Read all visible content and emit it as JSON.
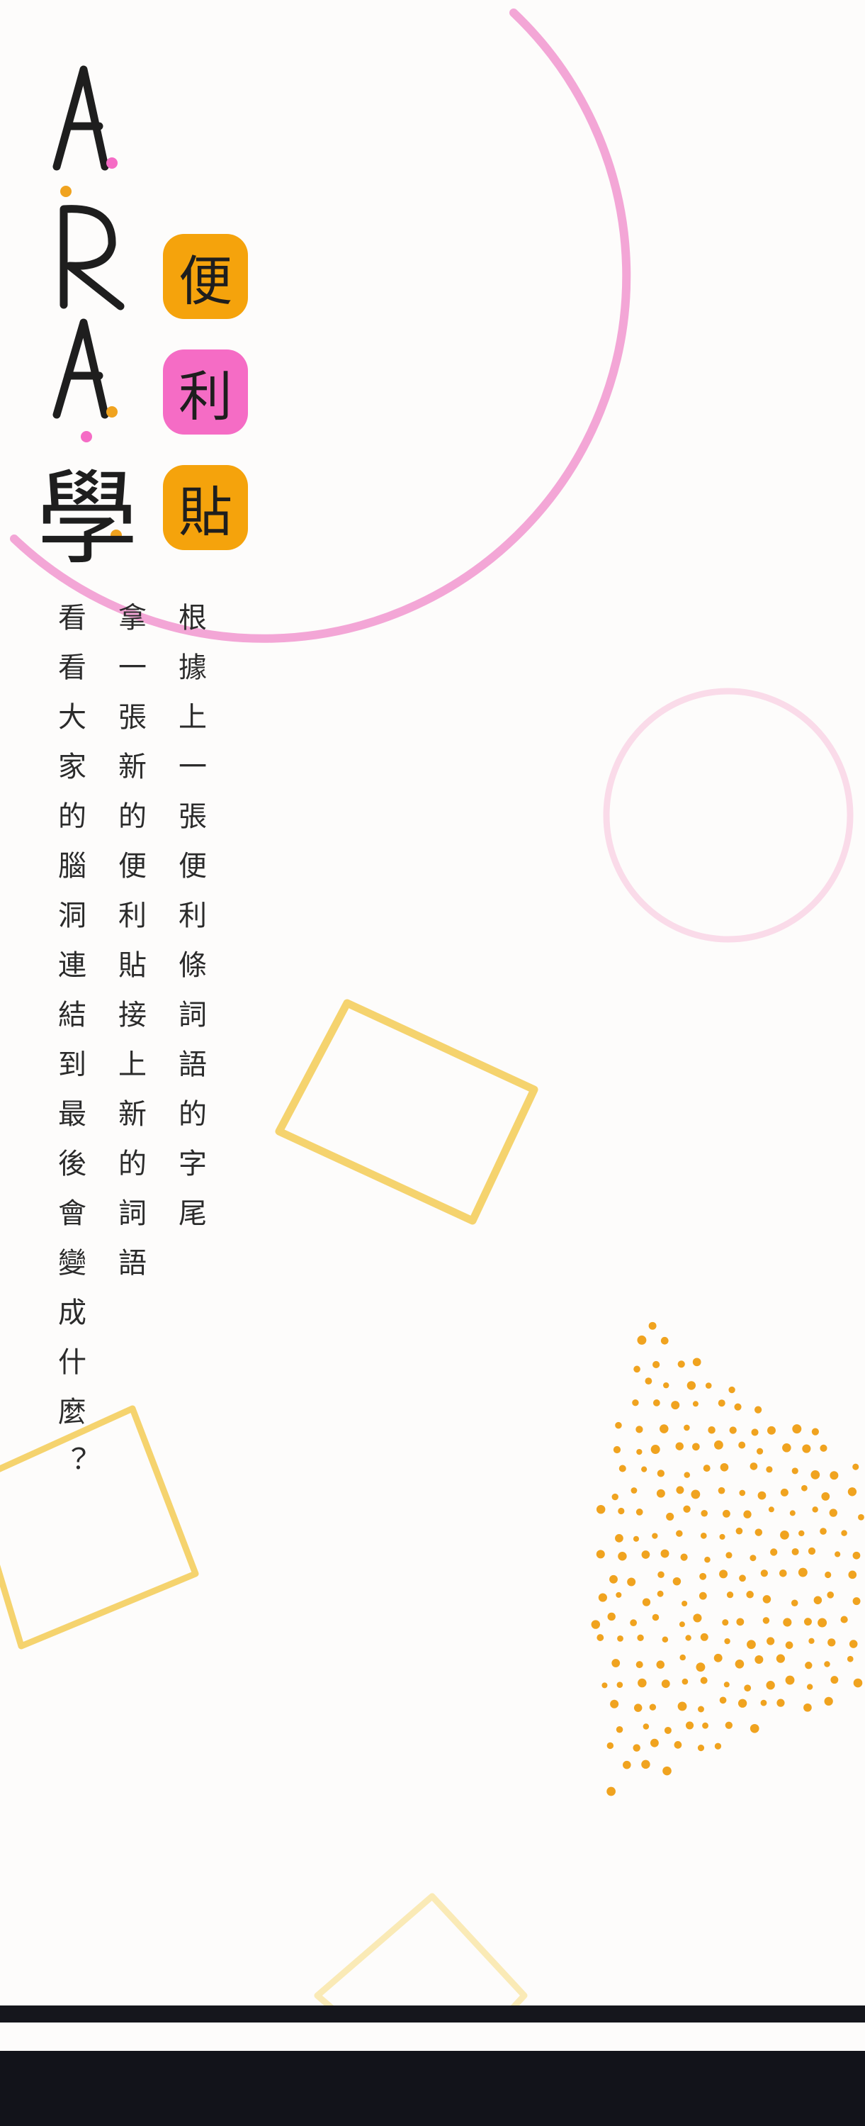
{
  "brand": {
    "logo_text": "A.R.A.學",
    "badges": [
      {
        "char": "便",
        "color": "#f5a30c"
      },
      {
        "char": "利",
        "color": "#f56cc5"
      },
      {
        "char": "貼",
        "color": "#f5a30c"
      }
    ]
  },
  "instructions": [
    "根據上一張便利條詞語的字尾",
    "拿一張新的便利貼接上新的詞語",
    "看看大家的腦洞連結到最後會變成什麼？"
  ],
  "colors": {
    "pink": "#f3a6d6",
    "pink_light": "#fadbe9",
    "yellow": "#f5d36e",
    "orange": "#f0a31f",
    "dark": "#15161c"
  }
}
